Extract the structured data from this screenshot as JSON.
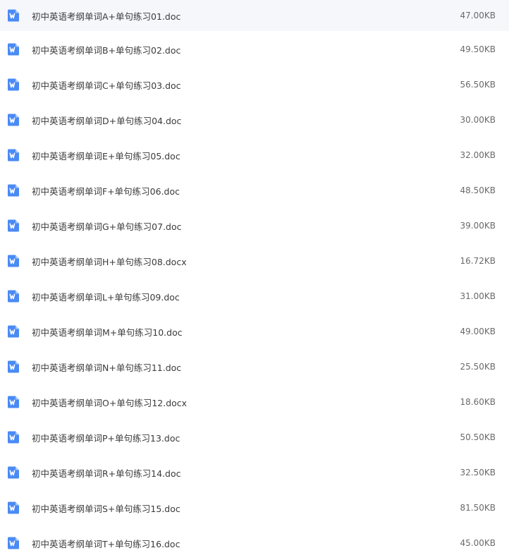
{
  "files": [
    {
      "name": "初中英语考纲单词A+单句练习01.doc",
      "size": "47.00KB",
      "icon": "word-doc-icon"
    },
    {
      "name": "初中英语考纲单词B+单句练习02.doc",
      "size": "49.50KB",
      "icon": "word-doc-icon"
    },
    {
      "name": "初中英语考纲单词C+单句练习03.doc",
      "size": "56.50KB",
      "icon": "word-doc-icon"
    },
    {
      "name": "初中英语考纲单词D+单句练习04.doc",
      "size": "30.00KB",
      "icon": "word-doc-icon"
    },
    {
      "name": "初中英语考纲单词E+单句练习05.doc",
      "size": "32.00KB",
      "icon": "word-doc-icon"
    },
    {
      "name": "初中英语考纲单词F+单句练习06.doc",
      "size": "48.50KB",
      "icon": "word-doc-icon"
    },
    {
      "name": "初中英语考纲单词G+单句练习07.doc",
      "size": "39.00KB",
      "icon": "word-doc-icon"
    },
    {
      "name": "初中英语考纲单词H+单句练习08.docx",
      "size": "16.72KB",
      "icon": "word-doc-icon"
    },
    {
      "name": "初中英语考纲单词L+单句练习09.doc",
      "size": "31.00KB",
      "icon": "word-doc-icon"
    },
    {
      "name": "初中英语考纲单词M+单句练习10.doc",
      "size": "49.00KB",
      "icon": "word-doc-icon"
    },
    {
      "name": "初中英语考纲单词N+单句练习11.doc",
      "size": "25.50KB",
      "icon": "word-doc-icon"
    },
    {
      "name": "初中英语考纲单词O+单句练习12.docx",
      "size": "18.60KB",
      "icon": "word-doc-icon"
    },
    {
      "name": "初中英语考纲单词P+单句练习13.doc",
      "size": "50.50KB",
      "icon": "word-doc-icon"
    },
    {
      "name": "初中英语考纲单词R+单句练习14.doc",
      "size": "32.50KB",
      "icon": "word-doc-icon"
    },
    {
      "name": "初中英语考纲单词S+单句练习15.doc",
      "size": "81.50KB",
      "icon": "word-doc-icon"
    },
    {
      "name": "初中英语考纲单词T+单句练习16.doc",
      "size": "45.00KB",
      "icon": "word-doc-icon"
    }
  ],
  "colors": {
    "icon_blue": "#4a8af4",
    "row_highlight": "#f5f7fb",
    "name_text": "#3a3a3a",
    "size_text": "#6a6a6a"
  }
}
